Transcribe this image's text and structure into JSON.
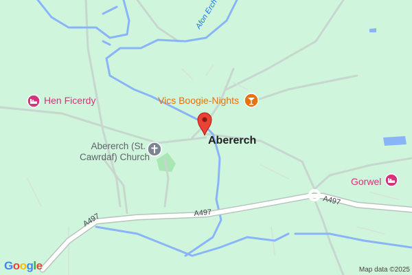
{
  "map": {
    "places": {
      "village": "Abererch"
    },
    "pois": {
      "hen_ficerdy": {
        "label": "Hen Ficerdy",
        "icon": "hotel-icon",
        "color": "#d6337c"
      },
      "gorwel": {
        "label": "Gorwel",
        "icon": "hotel-icon",
        "color": "#d6337c"
      },
      "vics_boogie_nights": {
        "label": "Vics Boogie-Nights",
        "icon": "cocktail-bar-icon",
        "color": "#e8710a"
      },
      "church": {
        "line1": "Abererch (St.",
        "line2": "Cawrdaf) Church",
        "icon": "church-icon",
        "color": "#7b8591"
      }
    },
    "roads": {
      "a497_left": "A497",
      "a497_middle": "A497",
      "a497_right": "A497"
    },
    "waterways": {
      "afon_erch": "Afon Erch"
    },
    "marker": {
      "icon": "location-pin-icon",
      "color": "#ea4335"
    },
    "colors": {
      "land": "#cff5dc",
      "water": "#8ab4f8",
      "road": "#ffffff",
      "minor_road": "#c5d3cc"
    }
  },
  "footer": {
    "logo": "Google",
    "attribution": "Map data ©2025"
  }
}
